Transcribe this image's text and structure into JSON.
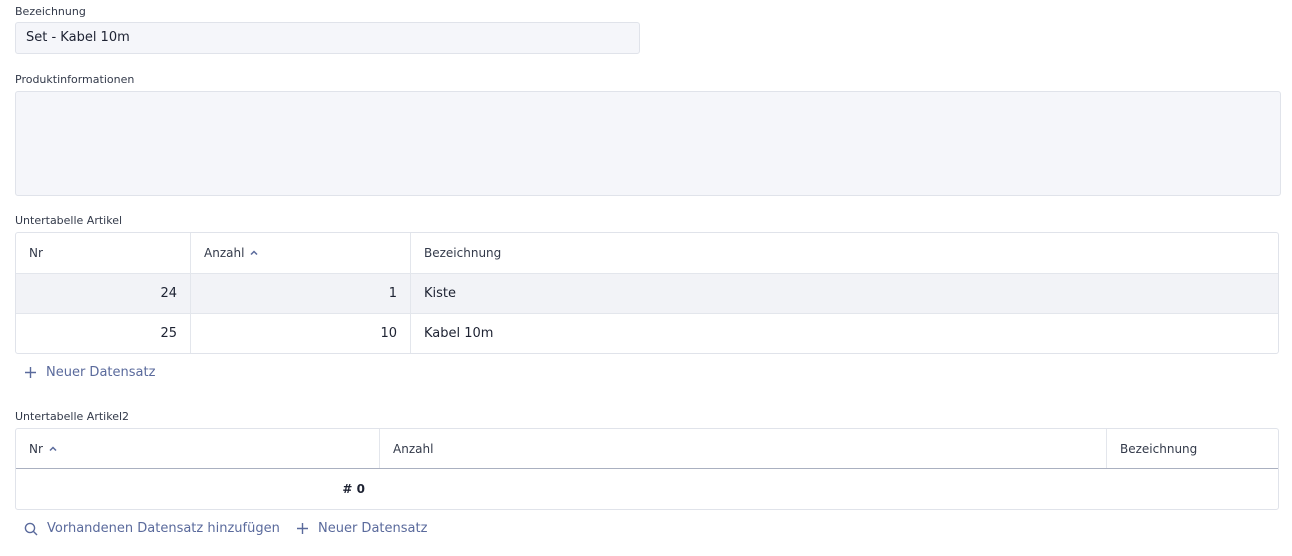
{
  "form": {
    "bezeichnung_label": "Bezeichnung",
    "bezeichnung_value": "Set - Kabel 10m",
    "produktinfo_label": "Produktinformationen",
    "produktinfo_value": ""
  },
  "subtable1": {
    "label": "Untertabelle Artikel",
    "columns": [
      "Nr",
      "Anzahl",
      "Bezeichnung"
    ],
    "sorted_column": "Anzahl",
    "rows": [
      {
        "nr": "24",
        "anzahl": "1",
        "bezeichnung": "Kiste"
      },
      {
        "nr": "25",
        "anzahl": "10",
        "bezeichnung": "Kabel 10m"
      }
    ],
    "new_record_label": "Neuer Datensatz"
  },
  "subtable2": {
    "label": "Untertabelle Artikel2",
    "columns": [
      "Nr",
      "Anzahl",
      "Bezeichnung"
    ],
    "sorted_column": "Nr",
    "count_label": "# 0",
    "add_existing_label": "Vorhandenen Datensatz hinzufügen",
    "new_record_label": "Neuer Datensatz"
  },
  "icons": {
    "plus": "plus-icon",
    "search": "search-icon",
    "sort_asc": "chevron-up-icon"
  },
  "colors": {
    "accent": "#5a6a9c",
    "input_bg": "#f5f6fa",
    "selected_row": "#f2f3f7"
  }
}
